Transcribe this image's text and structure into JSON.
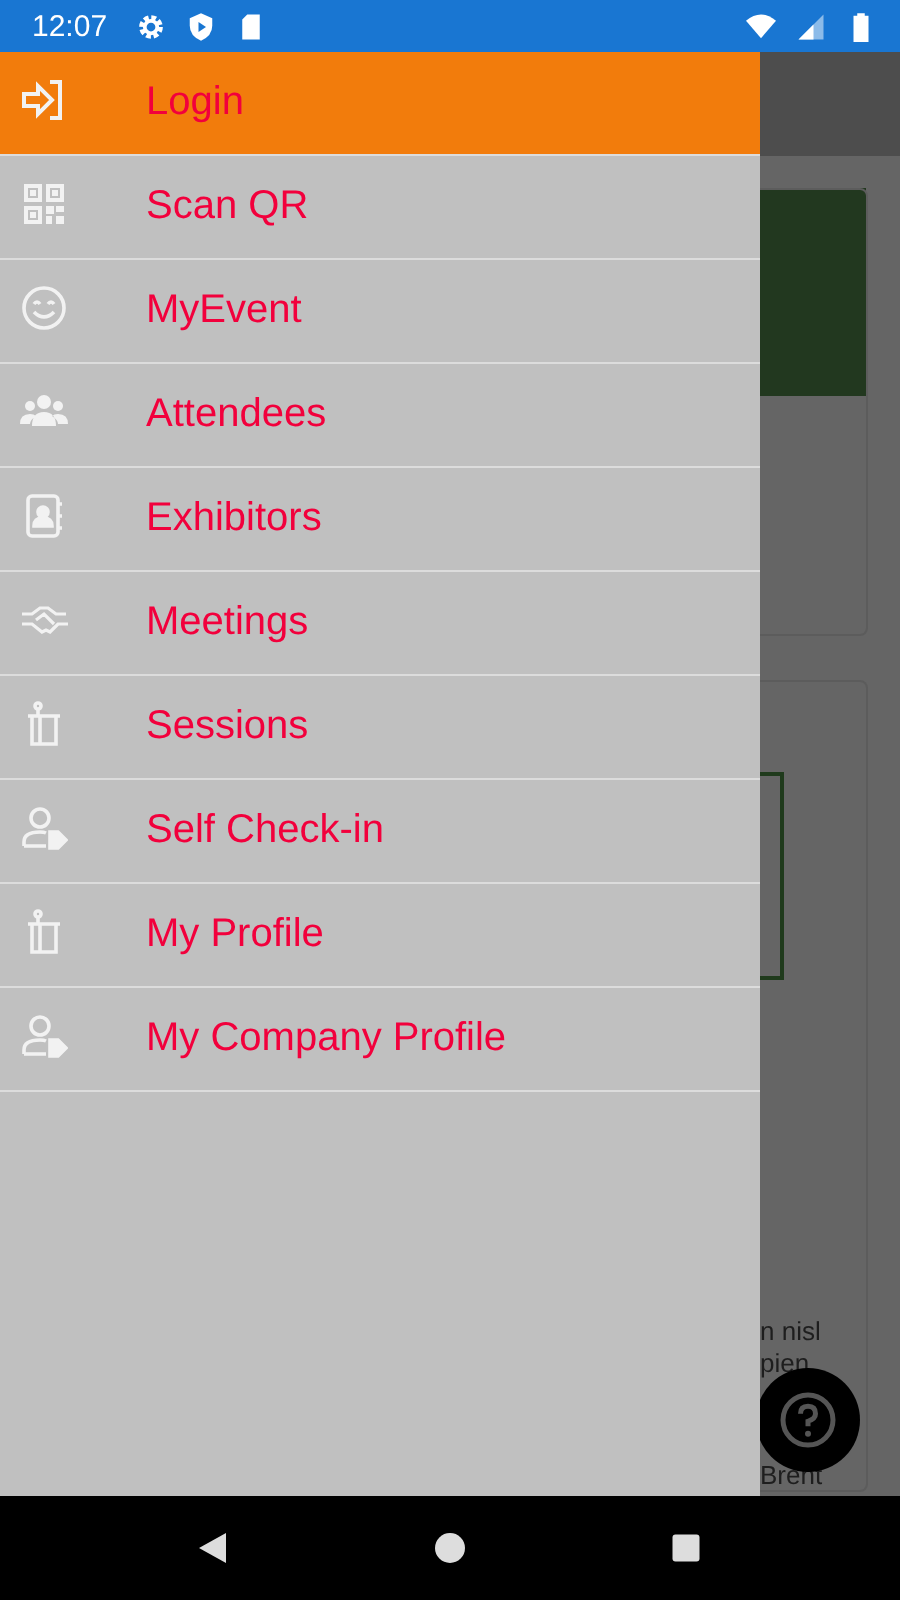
{
  "status_bar": {
    "time": "12:07"
  },
  "menu": [
    {
      "label": "Login",
      "kind": "login",
      "selected": true
    },
    {
      "label": "Scan QR",
      "kind": "qr",
      "selected": false
    },
    {
      "label": "MyEvent",
      "kind": "smile",
      "selected": false
    },
    {
      "label": "Attendees",
      "kind": "people",
      "selected": false
    },
    {
      "label": "Exhibitors",
      "kind": "contact",
      "selected": false
    },
    {
      "label": "Meetings",
      "kind": "handshake",
      "selected": false
    },
    {
      "label": "Sessions",
      "kind": "podium",
      "selected": false
    },
    {
      "label": "Self Check-in",
      "kind": "persontag",
      "selected": false
    },
    {
      "label": "My Profile",
      "kind": "podium",
      "selected": false
    },
    {
      "label": "My Company Profile",
      "kind": "persontag",
      "selected": false
    }
  ],
  "background_text": [
    "n nisl",
    "pien",
    "Brent"
  ]
}
